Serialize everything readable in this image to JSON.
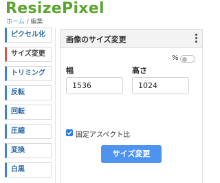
{
  "app": {
    "logo": "ResizePixel"
  },
  "breadcrumb": {
    "home": "ホーム",
    "separator": "/",
    "current": "編集"
  },
  "menu": {
    "items": [
      {
        "label": "ピクセル化"
      },
      {
        "label": "サイズ変更",
        "active": true
      },
      {
        "label": "トリミング"
      },
      {
        "label": "反転"
      },
      {
        "label": "回転"
      },
      {
        "label": "圧縮"
      },
      {
        "label": "変換"
      },
      {
        "label": "白黒"
      }
    ]
  },
  "panel": {
    "title": "画像のサイズ変更",
    "percent_label": "%",
    "percent_enabled": false,
    "width_label": "幅",
    "width_value": "1536",
    "height_label": "高さ",
    "height_value": "1024",
    "keep_aspect_label": "固定アスペクト比",
    "keep_aspect_checked": true,
    "submit_label": "サイズ変更"
  },
  "colors": {
    "logo": "#5aa52f",
    "accent": "#3d84c6",
    "active": "#d9534f",
    "button": "#4f93f0"
  }
}
